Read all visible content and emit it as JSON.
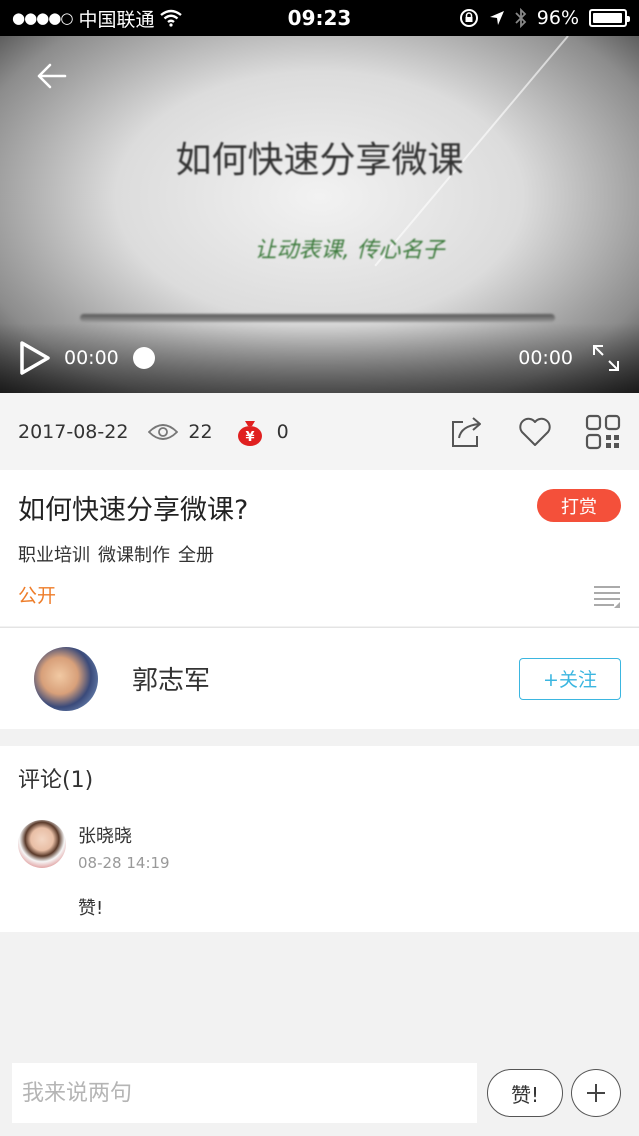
{
  "status_bar": {
    "signal_dots": "●●●●○",
    "carrier": "中国联通",
    "time": "09:23",
    "battery": "96%",
    "battery_level": 0.96,
    "icons": [
      "wifi-icon",
      "rotation-lock-icon",
      "location-icon",
      "bluetooth-icon",
      "battery-icon"
    ]
  },
  "video": {
    "slide_title": "如何快速分享微课",
    "slide_subtitle": "让动表课, 传心名子",
    "time_current": "00:00",
    "time_total": "00:00",
    "progress": 0
  },
  "meta": {
    "date": "2017-08-22",
    "views": "22",
    "rewards": "0"
  },
  "course": {
    "title": "如何快速分享微课?",
    "reward_label": "打赏",
    "tags": [
      "职业培训",
      "微课制作",
      "全册"
    ],
    "visibility": "公开"
  },
  "author": {
    "name": "郭志军",
    "follow_label": "+关注"
  },
  "comments": {
    "header": "评论(1)",
    "items": [
      {
        "user": "张晓晓",
        "time": "08-28 14:19",
        "text": "赞!"
      }
    ]
  },
  "input_bar": {
    "placeholder": "我来说两句",
    "like_label": "赞!"
  },
  "colors": {
    "accent_orange": "#ee7d2a",
    "reward_red": "#f4503a",
    "follow_blue": "#3bb6e0"
  }
}
